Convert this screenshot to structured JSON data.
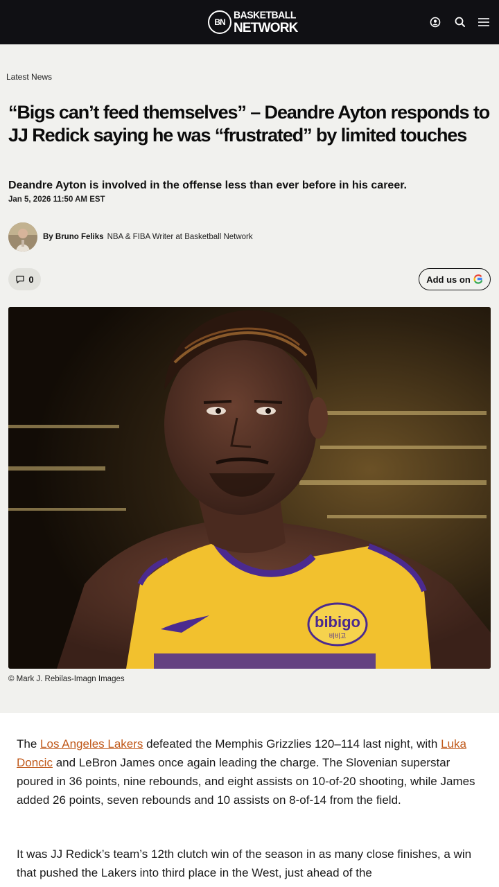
{
  "header": {
    "logo_badge": "BN",
    "logo_line1": "BASKETBALL",
    "logo_line2": "NETWORK",
    "icons": [
      "user-icon",
      "search-icon",
      "menu-icon"
    ]
  },
  "article": {
    "kicker": "Latest News",
    "headline": "“Bigs can’t feed themselves” – Deandre Ayton responds to JJ Redick saying he was “frustrated” by limited touches",
    "dek": "Deandre Ayton is involved in the offense less than ever before in his career.",
    "date": "Jan 5, 2026 11:50 AM EST",
    "author": {
      "by": "By Bruno Feliks",
      "role": "NBA & FIBA Writer at Basketball Network"
    },
    "comments_count": "0",
    "google_label": "Add us on",
    "image_credit": "© Mark J. Rebilas-Imagn Images",
    "jersey_text": "bibigo",
    "jersey_text_kr": "비비고",
    "body": {
      "p1": {
        "t1": "The ",
        "link1": "Los Angeles Lakers",
        "t2": " defeated the Memphis Grizzlies 120–114 last night, with ",
        "link2": "Luka Doncic",
        "t3": " and LeBron James once again leading the charge. The Slovenian superstar poured in 36 points, nine rebounds, and eight assists on 10-of-20 shooting, while James added 26 points, seven rebounds and 10 assists on 8-of-14 from the field."
      },
      "p2": "It was JJ Redick’s team’s 12th clutch win of the season in as many close finishes, a win that pushed the Lakers into third place in the West, just ahead of the"
    }
  },
  "colors": {
    "header_bg": "#101014",
    "page_bg": "#f1f1ee",
    "link": "#c0591a",
    "jersey_yellow": "#f2c12e",
    "jersey_purple": "#4b2a8f"
  }
}
